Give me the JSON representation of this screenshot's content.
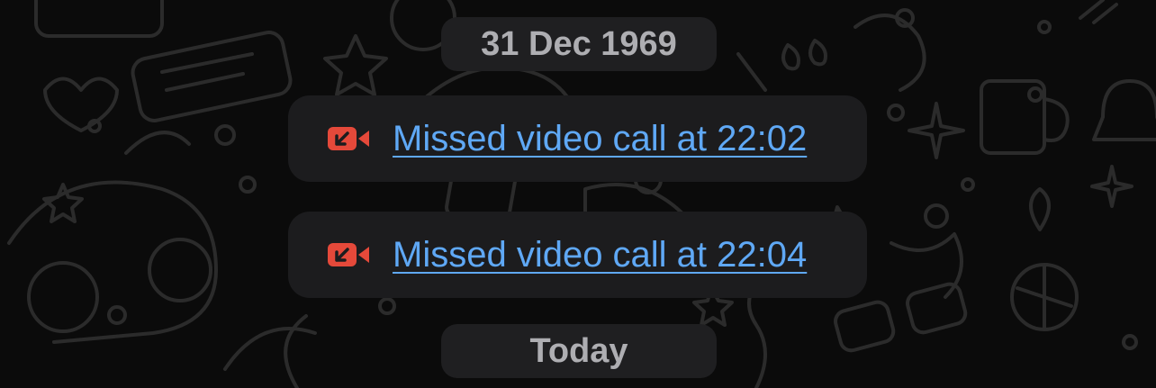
{
  "conversation": {
    "date_separator": "31 Dec 1969",
    "today_separator": "Today",
    "messages": [
      {
        "type": "missed-video-call",
        "text": "Missed video call at 22:02",
        "icon": "missed-video-call-icon"
      },
      {
        "type": "missed-video-call",
        "text": "Missed video call at 22:04",
        "icon": "missed-video-call-icon"
      }
    ]
  },
  "colors": {
    "background": "#0b0b0b",
    "pill_background": "#1f1f21",
    "pill_text": "#aeaeb2",
    "bubble_background": "#1c1c1e",
    "link": "#5fa8f5",
    "missed_call_icon": "#e5493a",
    "wallpaper_doodle": "#2b2b2b"
  }
}
